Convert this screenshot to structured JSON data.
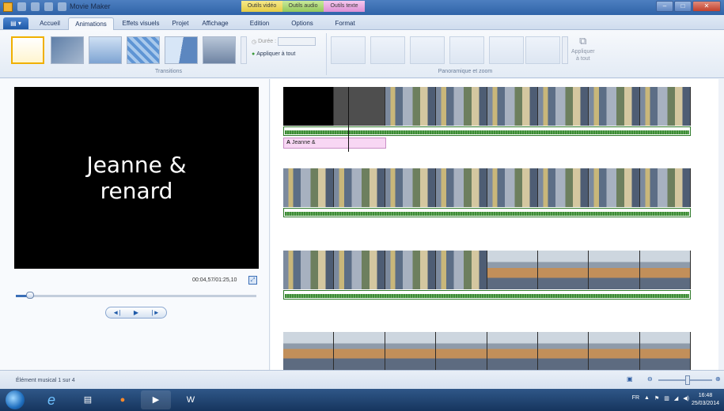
{
  "titlebar": {
    "app_title": "Movie Maker",
    "context_tabs": [
      "Outils vidéo",
      "Outils audio",
      "Outils texte"
    ]
  },
  "ribbon_tabs": [
    "Accueil",
    "Animations",
    "Effets visuels",
    "Projet",
    "Affichage",
    "Edition",
    "Options",
    "Format"
  ],
  "active_tab": "Animations",
  "ribbon": {
    "duration_label": "Durée :",
    "apply_all_label": "Appliquer à tout",
    "transitions_group": "Transitions",
    "panzoom_group": "Panoramique et zoom",
    "apply_all_right_label_1": "Appliquer",
    "apply_all_right_label_2": "à tout"
  },
  "preview": {
    "title_line1": "Jeanne &",
    "title_line2": "renard",
    "timecode": "00:04,57/01:25,10",
    "seek_fraction": 0.06,
    "controls": [
      "◄|",
      "▶",
      "|►"
    ]
  },
  "storyboard": {
    "caption_text": "Jeanne &",
    "caption_icon": "A"
  },
  "status": {
    "text": "Élément musical 1 sur 4",
    "zoom_fraction": 0.55
  },
  "taskbar": {
    "lang": "FR",
    "time": "16:48",
    "date": "25/03/2014"
  }
}
